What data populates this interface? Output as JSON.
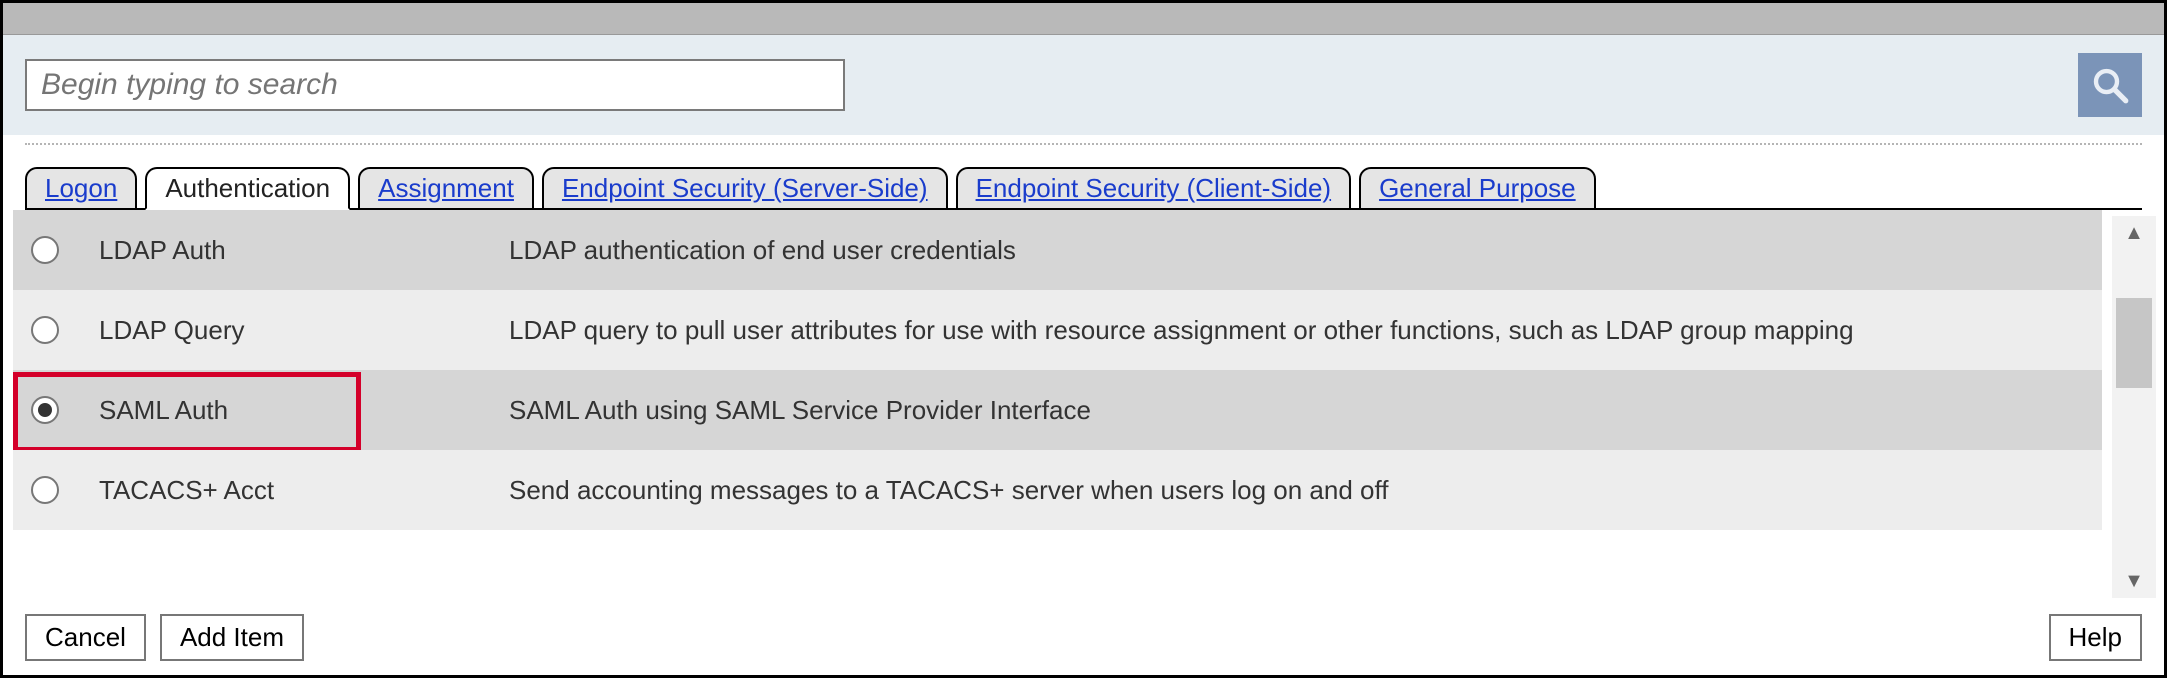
{
  "search": {
    "placeholder": "Begin typing to search"
  },
  "tabs": [
    {
      "label": "Logon",
      "active": false
    },
    {
      "label": "Authentication",
      "active": true
    },
    {
      "label": "Assignment",
      "active": false
    },
    {
      "label": "Endpoint Security (Server-Side)",
      "active": false
    },
    {
      "label": "Endpoint Security (Client-Side)",
      "active": false
    },
    {
      "label": "General Purpose",
      "active": false
    }
  ],
  "rows": [
    {
      "name": "LDAP Auth",
      "desc": "LDAP authentication of end user credentials",
      "selected": false
    },
    {
      "name": "LDAP Query",
      "desc": "LDAP query to pull user attributes for use with resource assignment or other functions, such as LDAP group mapping",
      "selected": false
    },
    {
      "name": "SAML Auth",
      "desc": "SAML Auth using SAML Service Provider Interface",
      "selected": true,
      "highlighted": true
    },
    {
      "name": "TACACS+ Acct",
      "desc": "Send accounting messages to a TACACS+ server when users log on and off",
      "selected": false
    }
  ],
  "buttons": {
    "cancel": "Cancel",
    "add": "Add Item",
    "help": "Help"
  }
}
